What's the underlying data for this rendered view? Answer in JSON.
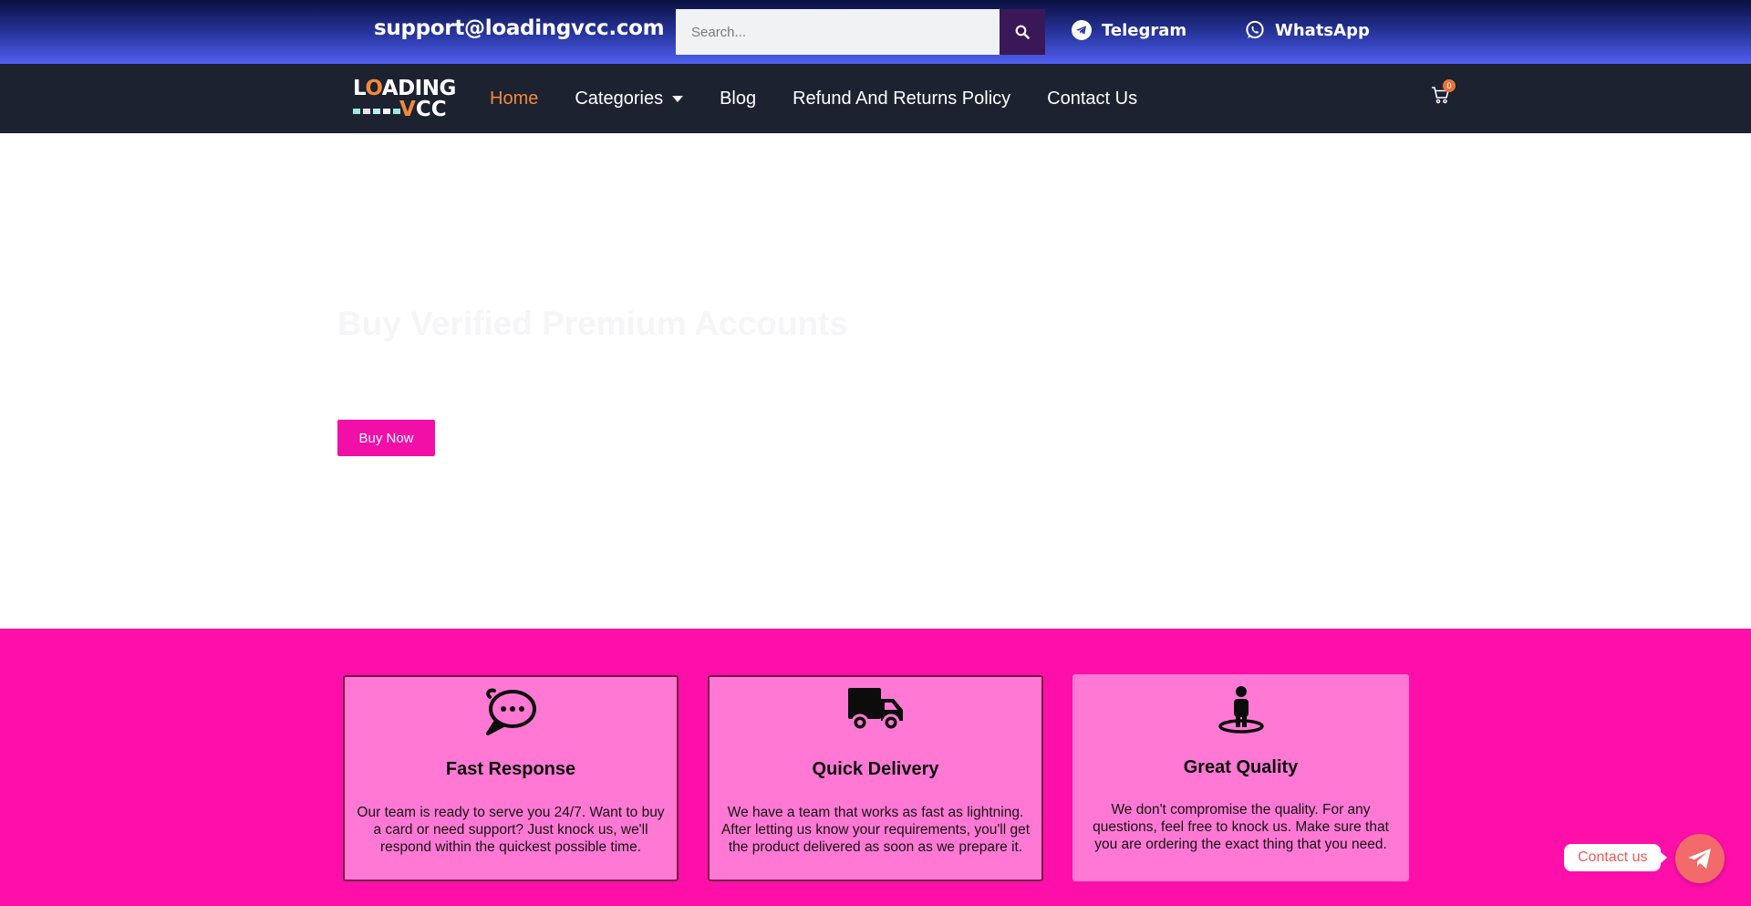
{
  "topbar": {
    "email": "support@loadingvcc.com",
    "search_placeholder": "Search...",
    "telegram_label": "Telegram",
    "whatsapp_label": "WhatsApp"
  },
  "logo": {
    "line1": "LOADING",
    "line2": "VCC"
  },
  "nav": {
    "items": [
      {
        "label": "Home",
        "active": true
      },
      {
        "label": "Categories"
      },
      {
        "label": "Blog"
      },
      {
        "label": "Refund And Returns Policy"
      },
      {
        "label": "Contact Us"
      }
    ],
    "cart_count": "0"
  },
  "hero": {
    "title": "Buy Verified Premium Accounts",
    "button_label": "Buy Now"
  },
  "features": [
    {
      "icon": "chat-bubble-icon",
      "title": "Fast Response",
      "text": "Our team is ready to serve you 24/7. Want to buy a card or need support? Just knock us, we'll respond within the quickest possible time."
    },
    {
      "icon": "delivery-truck-icon",
      "title": "Quick Delivery",
      "text": "We have a team that works as fast as lightning. After letting us know your requirements, you'll get the product delivered as soon as we prepare it."
    },
    {
      "icon": "person-pin-icon",
      "title": "Great Quality",
      "text": "We don't compromise the quality. For any questions, feel free to knock us. Make sure that you are ordering the exact thing that you need."
    }
  ],
  "floating": {
    "contact_label": "Contact us"
  },
  "colors": {
    "accent_orange": "#f08a3a",
    "pink": "#fe0faa",
    "card_pink": "#ff78d4",
    "navbar": "#1c2230",
    "fab": "#f26a6a"
  }
}
